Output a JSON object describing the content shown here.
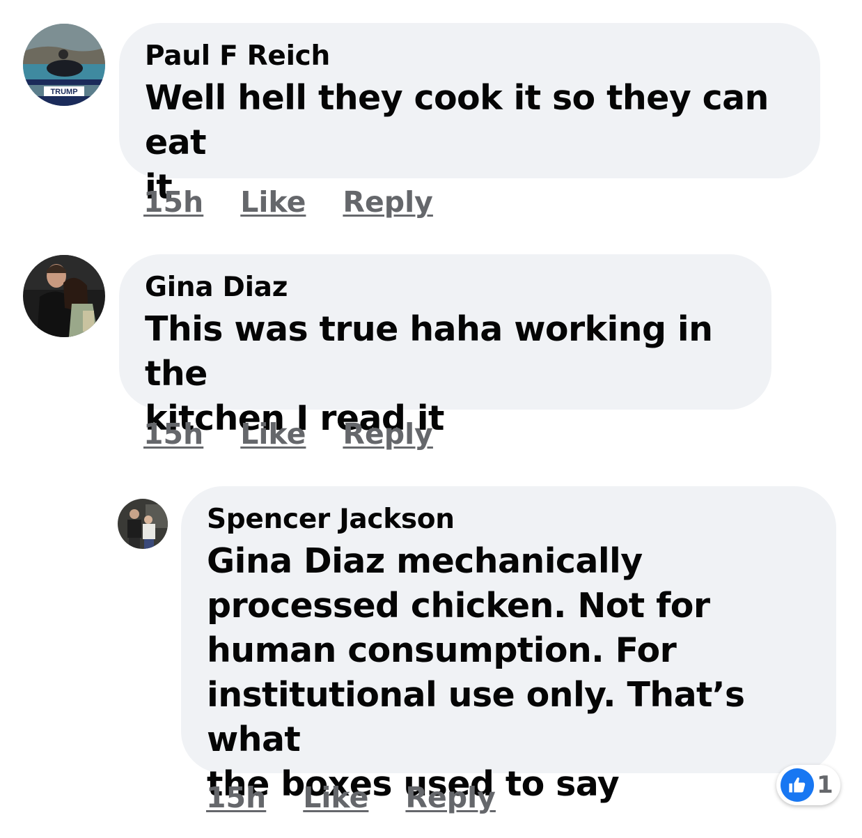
{
  "comments": [
    {
      "author": "Paul F Reich",
      "text_line1": "Well hell they cook it so they can eat",
      "text_line2": "it",
      "time": "15h",
      "like": "Like",
      "reply": "Reply"
    },
    {
      "author": "Gina Diaz",
      "text_line1": "This was true haha working in the",
      "text_line2": "kitchen I read it",
      "time": "15h",
      "like": "Like",
      "reply": "Reply"
    },
    {
      "author": "Spencer Jackson",
      "mention": "Gina Diaz",
      "text_line1_rest": " mechanically",
      "text_line2": "processed chicken. Not for",
      "text_line3": "human consumption. For",
      "text_line4": "institutional use only. That’s what",
      "text_line5": "the boxes used to say",
      "time": "15h",
      "like": "Like",
      "reply": "Reply",
      "reaction": {
        "icon": "thumbs-up-icon",
        "count": "1"
      }
    }
  ],
  "avatar_badge_text": "TRUMP",
  "colors": {
    "bubble": "#f0f2f5",
    "meta_text": "#65676b",
    "like_blue": "#1877f2"
  }
}
